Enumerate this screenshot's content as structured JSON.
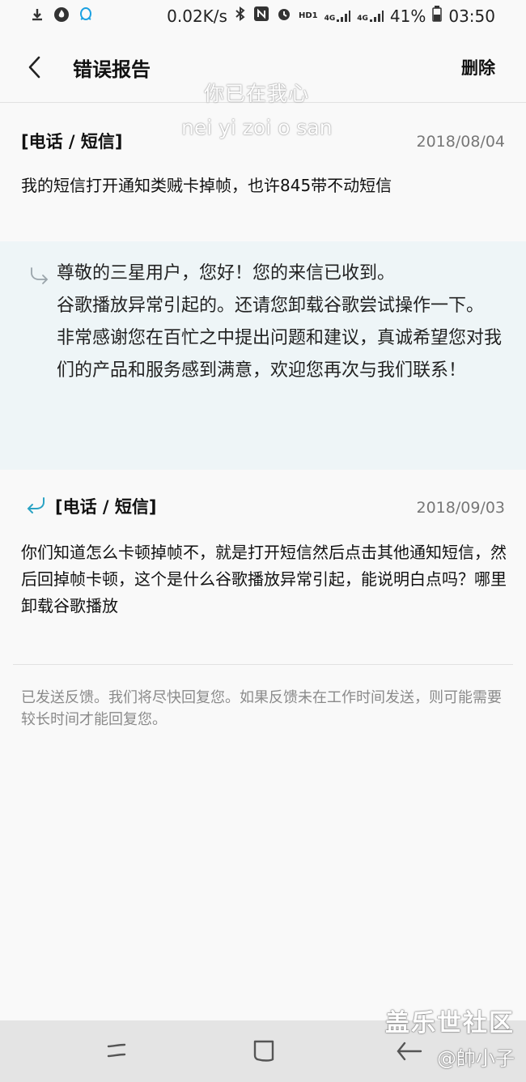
{
  "status_bar": {
    "net_speed": "0.02K/s",
    "hd": "HD1",
    "net1": "4G",
    "net2": "4G",
    "battery": "41%",
    "time": "03:50"
  },
  "header": {
    "title": "错误报告",
    "delete_label": "删除"
  },
  "watermark": {
    "line1": "你已在我心",
    "line2": "nei yi zoi o san"
  },
  "messages": [
    {
      "category": "[电话 / 短信]",
      "date": "2018/08/04",
      "text": "我的短信打开通知类贼卡掉帧，也许845带不动短信"
    },
    {
      "category": "[电话 / 短信]",
      "date": "2018/09/03",
      "text": "你们知道怎么卡顿掉帧不，就是打开短信然后点击其他通知短信，然后回掉帧卡顿，这个是什么谷歌播放异常引起，能说明白点吗？哪里卸载谷歌播放"
    }
  ],
  "reply": {
    "p1": "尊敬的三星用户，您好！您的来信已收到。",
    "p2": "谷歌播放异常引起的。还请您卸载谷歌尝试操作一下。",
    "p3": "非常感谢您在百忙之中提出问题和建议，真诚希望您对我们的产品和服务感到满意，欢迎您再次与我们联系！"
  },
  "footer_note": "已发送反馈。我们将尽快回复您。如果反馈未在工作时间发送，则可能需要较长时间才能回复您。",
  "overlay": {
    "forum": "盖乐世社区",
    "user": "@帥小子"
  },
  "colors": {
    "reply_bg": "#eef5f7",
    "accent_arrow": "#2ba3c4"
  }
}
